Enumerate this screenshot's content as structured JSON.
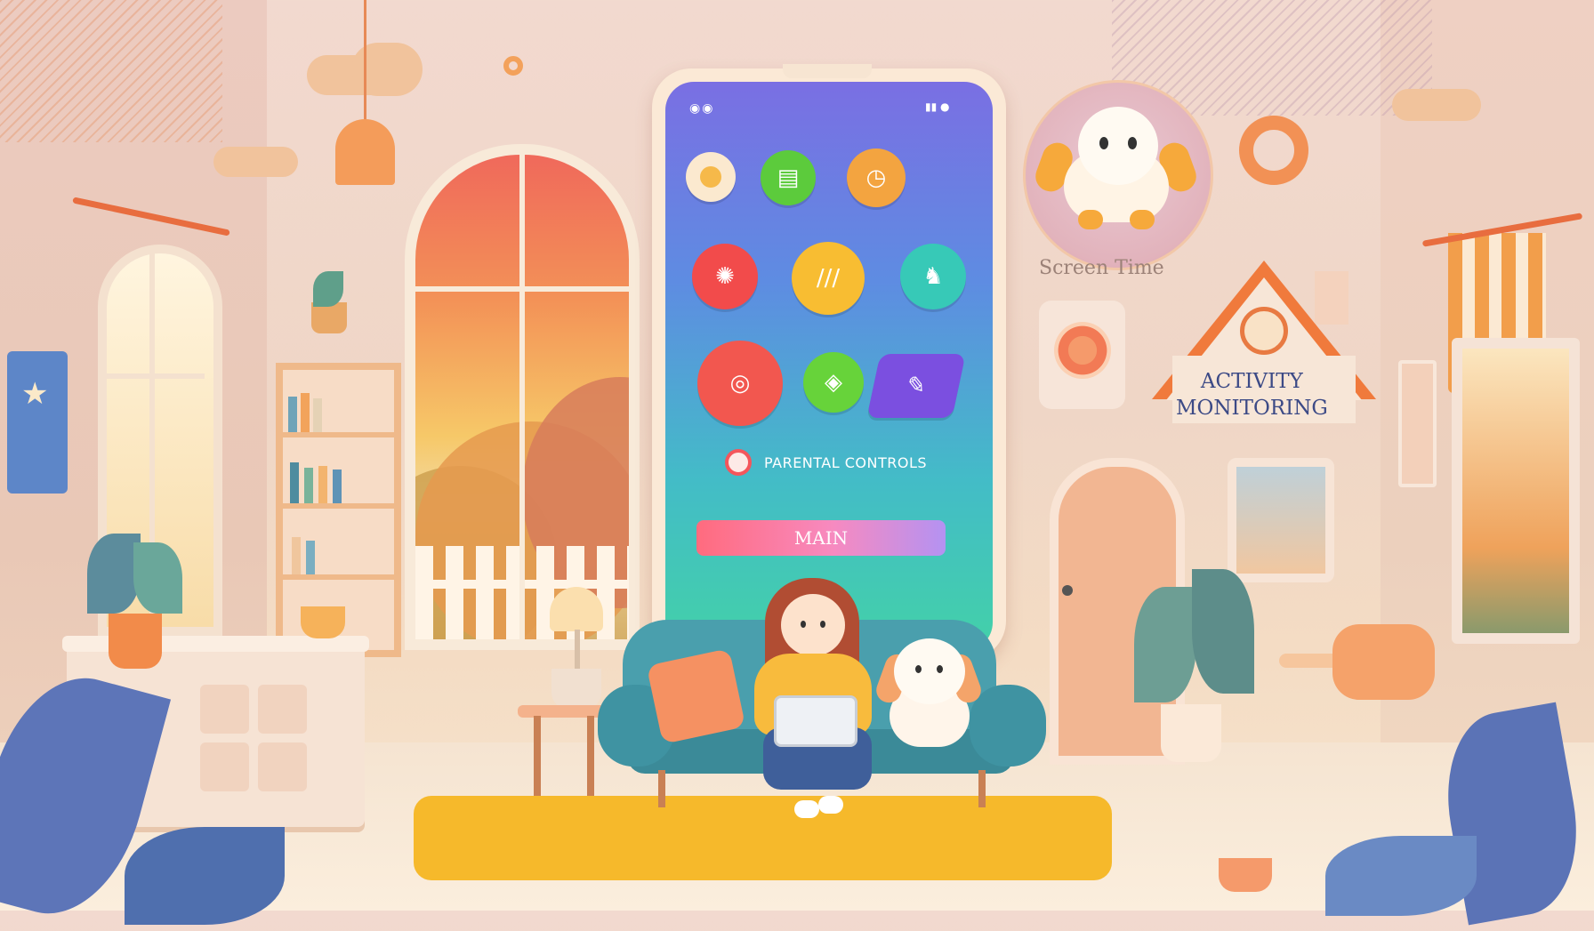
{
  "phone": {
    "parental_controls_label": "PARENTAL CONTROLS",
    "main_button_label": "MAIN",
    "apps": [
      {
        "icon": "lemon-icon",
        "color": "#f6b94a"
      },
      {
        "icon": "book-app-icon",
        "color": "#5ccb3c"
      },
      {
        "icon": "clock-app-icon",
        "color": "#f3a440"
      },
      {
        "icon": "ball-app-icon",
        "color": "#f24b4b"
      },
      {
        "icon": "stripes-app-icon",
        "color": "#f8bd32"
      },
      {
        "icon": "trophy-app-icon",
        "color": "#37c9b7"
      },
      {
        "icon": "target-app-icon",
        "color": "#f2574f"
      },
      {
        "icon": "shield-app-icon",
        "color": "#67d33a"
      },
      {
        "icon": "card-app-icon",
        "color": "#7b4fe0"
      }
    ]
  },
  "labels": {
    "screen_time": "Screen Time",
    "activity_line1": "ACTIVITY",
    "activity_line2": "MONITORING"
  },
  "colors": {
    "accent": "#f07a3c",
    "text_blue": "#3c4a86",
    "main_button_start": "#ff6b7e",
    "main_button_end": "#b492f2"
  }
}
